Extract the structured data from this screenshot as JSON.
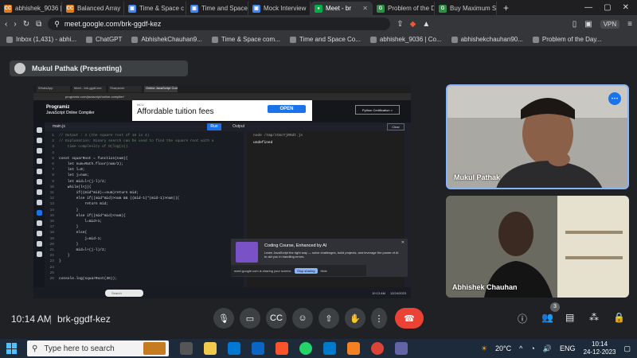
{
  "tabs": [
    {
      "label": "abhishek_9036 |",
      "color": "#e07a1f",
      "glyph": "CC",
      "active": false
    },
    {
      "label": "Balanced Array",
      "color": "#e07a1f",
      "glyph": "CC",
      "active": false
    },
    {
      "label": "Time & Space c",
      "color": "#4285f4",
      "glyph": "▣",
      "active": false
    },
    {
      "label": "Time and Space",
      "color": "#4285f4",
      "glyph": "▣",
      "active": false
    },
    {
      "label": "Mock Interview",
      "color": "#4285f4",
      "glyph": "▣",
      "active": false
    },
    {
      "label": "Meet - br",
      "color": "#00ac47",
      "glyph": "●",
      "active": true
    },
    {
      "label": "Problem of the D",
      "color": "#2f8d46",
      "glyph": "G",
      "active": false
    },
    {
      "label": "Buy Maximum S",
      "color": "#2f8d46",
      "glyph": "G",
      "active": false
    }
  ],
  "url": "meet.google.com/brk-ggdf-kez",
  "vpn": "VPN",
  "bookmarks": [
    "Inbox (1,431) - abhi...",
    "ChatGPT",
    "AbhishekChauhan9...",
    "Time & Space com...",
    "Time and Space Co...",
    "abhishek_9036 | Co...",
    "abhishekchauhan90...",
    "Problem of the Day..."
  ],
  "presenter": "Mukul Pathak (Presenting)",
  "shared": {
    "tabs": [
      "WhatsApp",
      "Meet - brk-ggdf-kez",
      "Sharpener",
      "Online JavaScript Compiler (Edi"
    ],
    "url": "programiz.com/javascript/online-compiler/",
    "logo": "Programiz",
    "logo_sub": "JavaScript Online Compiler",
    "ad_small": "NCU",
    "ad_title": "Affordable tuition fees",
    "ad_btn": "OPEN",
    "cert": "Python Certification >",
    "file": "main.js",
    "run": "Run",
    "output": "Output",
    "clear": "Clear",
    "code": [
      "// Output : 4 (the square root of 16 is 4)",
      "// Explanation: Binary search can be used to find the square root with a",
      "    time complexity of O(log(n)).",
      "",
      "const squarRoot = function(num){",
      "    let num=Math.floor(num/2);",
      "    let l=0;",
      "    let j=num;",
      "    let mid=l+(j-l)/2;",
      "    while(l<j){",
      "        if((mid*mid)==num)return mid;",
      "        else if((mid*mid)>num && ((mid-1)*(mid-1)>num)){",
      "            return mid;",
      "        }",
      "        else if((mid*mid)<num){",
      "            l=mid+1;",
      "        }",
      "        else{",
      "            j=mid-1;",
      "        }",
      "        mid=l+(j-l)/2;",
      "    }",
      "}",
      "",
      "",
      "console.log(squarRoot(36));"
    ],
    "out_lines": [
      "node /tmp/ztmcYjR9dt.js",
      "undefined"
    ],
    "popup_title": "Coding Course, Enhanced by AI",
    "popup_body": "Learn JavaScript the right way — solve challenges, build projects, and leverage the power of AI to aid you in handling errors.",
    "sharing_text": "meet.google.com is sharing your screen.",
    "stop": "Stop sharing",
    "hide": "Hide",
    "search": "Search",
    "time": "10:13 AM",
    "date": "12/24/2023"
  },
  "participants": [
    "Mukul Pathak",
    "Abhishek Chauhan"
  ],
  "clock": "10:14 AM",
  "meeting_code": "brk-ggdf-kez",
  "people_count": "3",
  "taskbar": {
    "search": "Type here to search",
    "weather": "20°C",
    "lang": "ENG",
    "time": "10:14",
    "date": "24-12-2023"
  }
}
